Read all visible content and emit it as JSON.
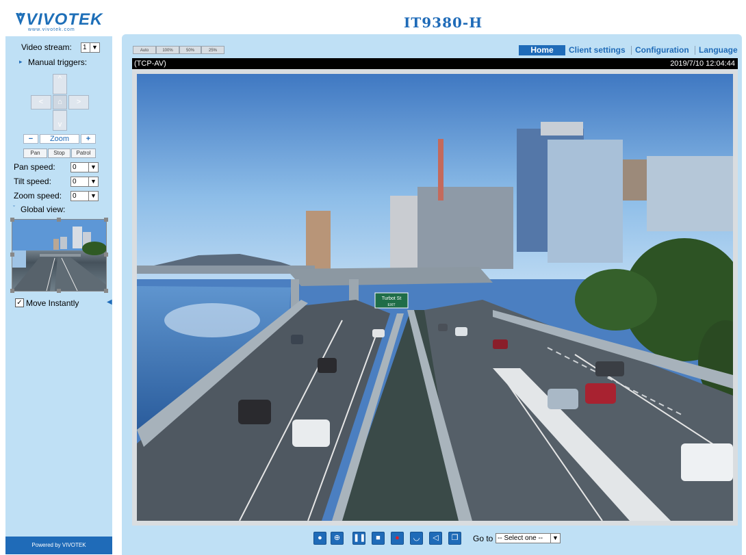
{
  "brand": {
    "logo_text": "VIVOTEK",
    "logo_sub": "www.vivotek.com",
    "powered_by": "Powered by VIVOTEK"
  },
  "header": {
    "model": "IT9380-H"
  },
  "sidebar": {
    "video_stream_label": "Video stream:",
    "video_stream_value": "1",
    "manual_triggers_label": "Manual triggers:",
    "zoom_label": "Zoom",
    "zoom_out": "−",
    "zoom_in": "+",
    "pan_btn": "Pan",
    "stop_btn": "Stop",
    "patrol_btn": "Patrol",
    "pan_speed_label": "Pan speed:",
    "pan_speed_value": "0",
    "tilt_speed_label": "Tilt speed:",
    "tilt_speed_value": "0",
    "zoom_speed_label": "Zoom speed:",
    "zoom_speed_value": "0",
    "global_view_label": "Global view:",
    "move_instantly_label": "Move Instantly",
    "move_instantly_checked": true
  },
  "view_sizes": [
    "Auto",
    "100%",
    "50%",
    "25%"
  ],
  "nav": {
    "home": "Home",
    "client_settings": "Client settings",
    "configuration": "Configuration",
    "language": "Language"
  },
  "stream": {
    "protocol": "(TCP-AV)",
    "timestamp": "2019/7/10 12:04:44"
  },
  "scene_sign": {
    "line1": "Turbot St",
    "line2": "EXIT"
  },
  "controls": {
    "goto_label": "Go to",
    "goto_value": "-- Select one --"
  }
}
